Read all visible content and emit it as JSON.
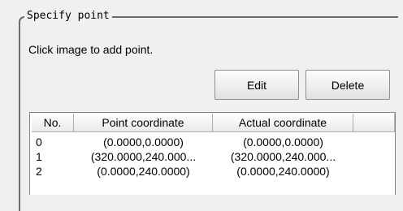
{
  "group": {
    "title": "Specify point"
  },
  "instruction": "Click image to add point.",
  "buttons": {
    "edit": "Edit",
    "delete": "Delete"
  },
  "table": {
    "columns": [
      "No.",
      "Point coordinate",
      "Actual coordinate",
      ""
    ],
    "rows": [
      {
        "no": "0",
        "point": "(0.0000,0.0000)",
        "actual": "(0.0000,0.0000)"
      },
      {
        "no": "1",
        "point": "(320.0000,240.000...",
        "actual": "(320.0000,240.000..."
      },
      {
        "no": "2",
        "point": "(0.0000,240.0000)",
        "actual": "(0.0000,240.0000)"
      }
    ]
  }
}
